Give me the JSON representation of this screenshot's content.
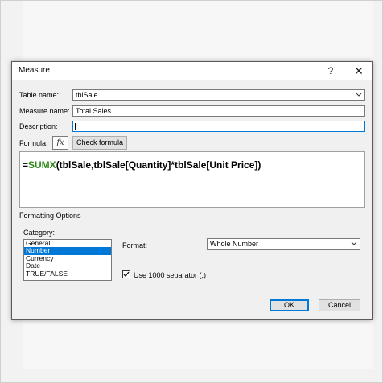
{
  "dialog": {
    "title": "Measure",
    "help_glyph": "?",
    "close_glyph": "✕"
  },
  "fields": {
    "table_name_label": "Table name:",
    "table_name_value": "tblSale",
    "measure_name_label": "Measure name:",
    "measure_name_value": "Total Sales",
    "description_label": "Description:",
    "description_value": ""
  },
  "formula": {
    "label": "Formula:",
    "fx_glyph": "fx",
    "check_button": "Check formula",
    "prefix": "=",
    "function": "SUMX",
    "rest": "(tblSale,tblSale[Quantity]*tblSale[Unit Price])"
  },
  "formatting": {
    "section_title": "Formatting Options",
    "category_label": "Category:",
    "categories": [
      "General",
      "Number",
      "Currency",
      "Date",
      "TRUE/FALSE"
    ],
    "selected_category": "Number",
    "format_label": "Format:",
    "format_value": "Whole Number",
    "separator_label": "Use 1000 separator (,)",
    "separator_checked": true
  },
  "buttons": {
    "ok": "OK",
    "cancel": "Cancel"
  },
  "colors": {
    "selection": "#0078d7",
    "function_name": "#2e8b1a",
    "dialog_bg": "#f0f0f0"
  }
}
